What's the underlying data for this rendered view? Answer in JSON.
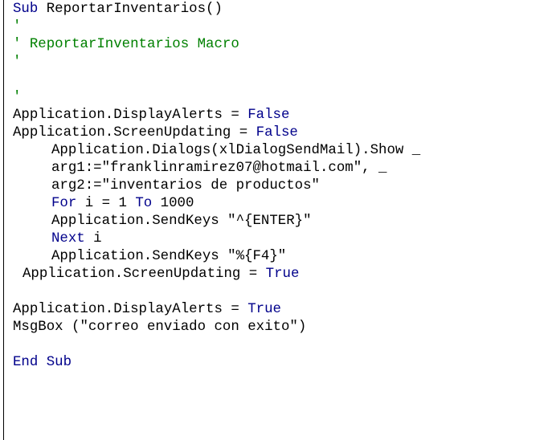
{
  "code": {
    "sub_kw": "Sub",
    "sub_name": " ReportarInventarios()",
    "comment_1": "'",
    "comment_2": "' ReportarInventarios Macro",
    "comment_3": "'",
    "comment_4": "'",
    "line_display_alerts_off": "Application.DisplayAlerts = ",
    "false_1": "False",
    "line_screen_updating_off": "Application.ScreenUpdating = ",
    "false_2": "False",
    "line_dialogs_show": "Application.Dialogs(xlDialogSendMail).Show _",
    "line_arg1": "arg1:=\"franklinramirez07@hotmail.com\", _",
    "line_arg2": "arg2:=\"inventarios de productos\"",
    "for_kw": "For",
    "for_mid": " i = 1 ",
    "to_kw": "To",
    "for_end": " 1000",
    "line_sendkeys_enter": "Application.SendKeys \"^{ENTER}\"",
    "next_kw": "Next",
    "next_var": " i",
    "line_sendkeys_f4": "Application.SendKeys \"%{F4}\"",
    "line_screen_updating_on": "Application.ScreenUpdating = ",
    "true_1": "True",
    "line_display_alerts_on": "Application.DisplayAlerts = ",
    "true_2": "True",
    "line_msgbox": "MsgBox (\"correo enviado con exito\")",
    "end_sub_kw": "End Sub"
  },
  "colors": {
    "keyword": "#00008b",
    "comment": "#008000",
    "text": "#000000"
  }
}
